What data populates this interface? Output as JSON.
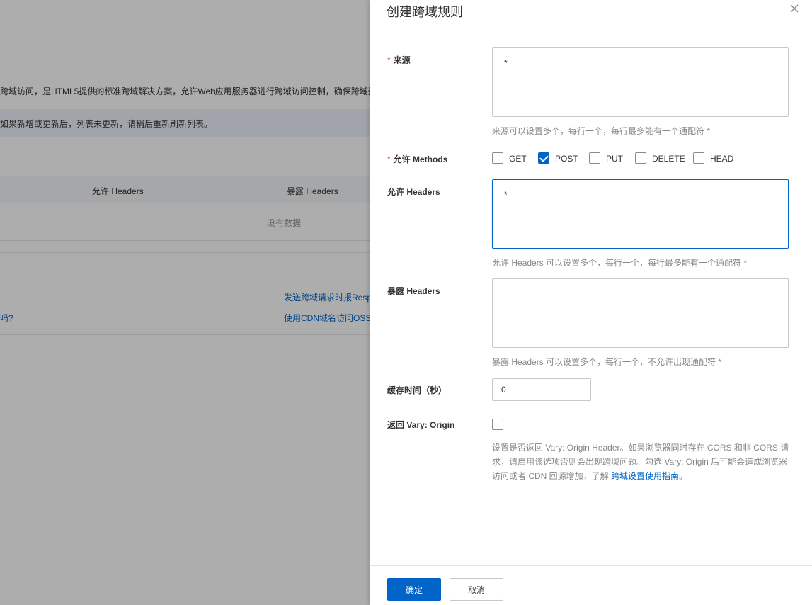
{
  "background": {
    "intro_text": "跨域访问，是HTML5提供的标准跨域解决方案，允许Web应用服务器进行跨域访问控制，确保跨域数",
    "notice_text": "如果新增或更新后，列表未更新，请稍后重新刷新列表。",
    "table_headers": [
      "允许 Headers",
      "暴露 Headers"
    ],
    "empty_text": "没有数据",
    "link1": "发送跨域请求时报Resp",
    "link2": "使用CDN域名访问OSS",
    "link3": "吗?"
  },
  "drawer": {
    "title": "创建跨域规则",
    "close_icon": "close-icon",
    "origin": {
      "label": "来源",
      "required_mark": "*",
      "value": "*",
      "help": "来源可以设置多个，每行一个，每行最多能有一个通配符 *"
    },
    "methods": {
      "label": "允许 Methods",
      "required_mark": "*",
      "options": [
        {
          "label": "GET",
          "checked": false
        },
        {
          "label": "POST",
          "checked": true
        },
        {
          "label": "PUT",
          "checked": false
        },
        {
          "label": "DELETE",
          "checked": false
        },
        {
          "label": "HEAD",
          "checked": false
        }
      ]
    },
    "allow_headers": {
      "label": "允许 Headers",
      "value": "*",
      "help": "允许 Headers 可以设置多个，每行一个，每行最多能有一个通配符 *"
    },
    "expose_headers": {
      "label": "暴露 Headers",
      "value": "",
      "help": "暴露 Headers 可以设置多个，每行一个，不允许出现通配符 *"
    },
    "cache_time": {
      "label": "缓存时间（秒）",
      "value": "0"
    },
    "vary": {
      "label": "返回 Vary: Origin",
      "checked": false,
      "desc": "设置是否返回 Vary: Origin Header。如果浏览器同时存在 CORS 和非 CORS 请求，请启用该选项否则会出现跨域问题。勾选 Vary: Origin 后可能会造成浏览器访问或者 CDN 回源增加，了解 ",
      "link": "跨域设置使用指南",
      "link_suffix": "。"
    },
    "footer": {
      "confirm": "确定",
      "cancel": "取消"
    }
  },
  "colors": {
    "accent": "#0064c8",
    "required": "#e3524f",
    "help": "#888888"
  }
}
